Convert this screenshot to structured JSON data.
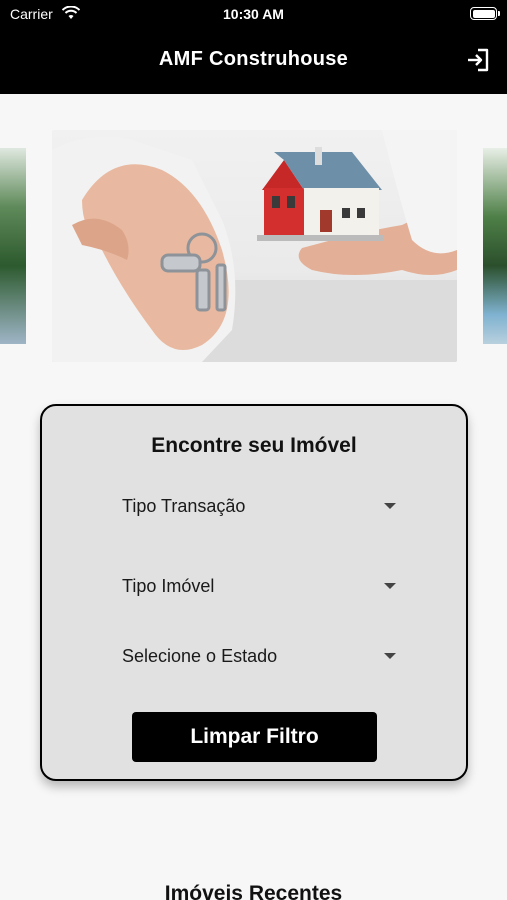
{
  "status_bar": {
    "carrier": "Carrier",
    "time": "10:30 AM"
  },
  "header": {
    "title": "AMF Construhouse",
    "logout_icon": "logout-icon"
  },
  "filter": {
    "title": "Encontre seu Imóvel",
    "dropdowns": [
      {
        "label": "Tipo Transação"
      },
      {
        "label": "Tipo Imóvel"
      },
      {
        "label": "Selecione o Estado"
      }
    ],
    "clear_button": "Limpar Filtro"
  },
  "recent": {
    "title": "Imóveis Recentes"
  },
  "colors": {
    "header_bg": "#000000",
    "card_bg": "#e1e1e1",
    "button_bg": "#000000",
    "page_bg": "#f7f7f7"
  }
}
